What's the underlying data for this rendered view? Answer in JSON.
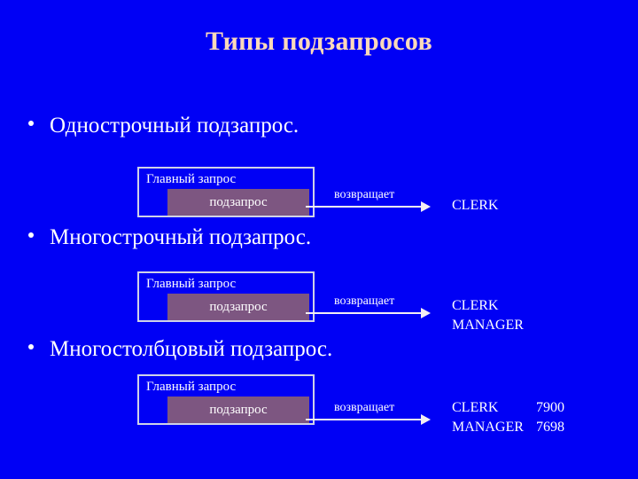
{
  "slide": {
    "title": "Типы подзапросов",
    "background_color": "#0000f5",
    "title_color": "#fcd9bb",
    "text_color": "#ffffff",
    "inner_box_color": "#7d5681",
    "box_border_color": "#cfd2e8",
    "sections": [
      {
        "bullet": "Однострочный подзапрос.",
        "outer_label": "Главный запрос",
        "inner_label": "подзапрос",
        "arrow_label": "возвращает",
        "results": [
          {
            "name": "CLERK",
            "value": ""
          }
        ]
      },
      {
        "bullet": "Многострочный подзапрос.",
        "outer_label": "Главный запрос",
        "inner_label": "подзапрос",
        "arrow_label": "возвращает",
        "results": [
          {
            "name": "CLERK",
            "value": ""
          },
          {
            "name": "MANAGER",
            "value": ""
          }
        ]
      },
      {
        "bullet": "Многостолбцовый подзапрос.",
        "outer_label": "Главный запрос",
        "inner_label": "подзапрос",
        "arrow_label": "возвращает",
        "results": [
          {
            "name": "CLERK",
            "value": "7900"
          },
          {
            "name": "MANAGER",
            "value": "7698"
          }
        ]
      }
    ]
  }
}
